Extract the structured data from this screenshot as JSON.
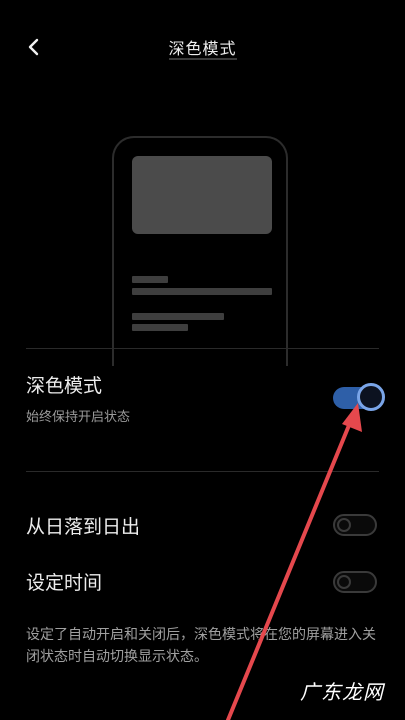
{
  "header": {
    "title": "深色模式",
    "back_icon": "chevron-left-icon"
  },
  "preview": {
    "icon": "phone-preview-illustration"
  },
  "dark_mode": {
    "title": "深色模式",
    "subtitle": "始终保持开启状态",
    "enabled": true
  },
  "sunset_to_sunrise": {
    "title": "从日落到日出",
    "enabled": false
  },
  "schedule": {
    "title": "设定时间",
    "enabled": false
  },
  "note": "设定了自动开启和关闭后，深色模式将在您的屏幕进入关闭状态时自动切换显示状态。",
  "watermark": "广东龙网",
  "colors": {
    "background": "#000000",
    "toggle_on": "#2e5fa8",
    "toggle_on_knob_ring": "#7aa5e8",
    "annotation_arrow": "#e5484d"
  }
}
